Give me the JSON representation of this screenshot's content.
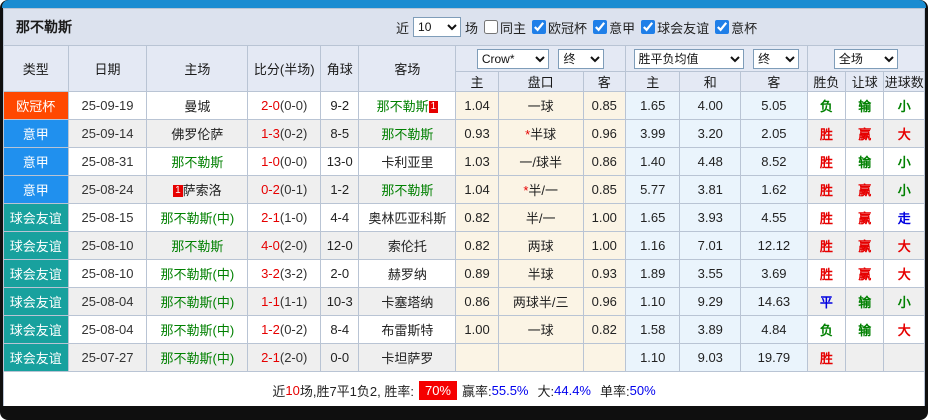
{
  "header": {
    "team": "那不勒斯",
    "near_label": "近",
    "matches_count": "10",
    "matches_unit": "场",
    "same_home": {
      "label": "同主",
      "checked": false
    },
    "filters": [
      {
        "label": "欧冠杯",
        "checked": true
      },
      {
        "label": "意甲",
        "checked": true
      },
      {
        "label": "球会友谊",
        "checked": true
      },
      {
        "label": "意杯",
        "checked": true
      }
    ]
  },
  "controls": {
    "asian_company": "Crow*",
    "asian_time": "终",
    "euro_company": "胜平负均值",
    "euro_time": "终",
    "scope": "全场"
  },
  "table": {
    "columns": [
      "类型",
      "日期",
      "主场",
      "比分(半场)",
      "角球",
      "客场",
      "主",
      "盘口",
      "客",
      "主",
      "和",
      "客",
      "胜负",
      "让球",
      "进球数"
    ],
    "rows": [
      {
        "type": "欧冠杯",
        "type_cls": "ucl",
        "date": "25-09-19",
        "home": {
          "name": "曼城",
          "team": false,
          "badge_before": "",
          "badge_after": ""
        },
        "away": {
          "name": "那不勒斯",
          "team": true,
          "badge_before": "",
          "badge_after": "1"
        },
        "score_ft": "2-0",
        "score_ht": "(0-0)",
        "corners": "9-2",
        "asian": {
          "home": "1.04",
          "star": false,
          "handicap": "一球",
          "away": "0.85"
        },
        "euro": {
          "home": "1.65",
          "draw": "4.00",
          "away": "5.05"
        },
        "result": {
          "t": "负",
          "c": "green"
        },
        "give": {
          "t": "输",
          "c": "green"
        },
        "goals": {
          "t": "小",
          "c": "green"
        }
      },
      {
        "type": "意甲",
        "type_cls": "seriea",
        "date": "25-09-14",
        "home": {
          "name": "佛罗伦萨",
          "team": false,
          "badge_before": "",
          "badge_after": ""
        },
        "away": {
          "name": "那不勒斯",
          "team": true,
          "badge_before": "",
          "badge_after": ""
        },
        "score_ft": "1-3",
        "score_ht": "(0-2)",
        "corners": "8-5",
        "asian": {
          "home": "0.93",
          "star": true,
          "handicap": "半球",
          "away": "0.96"
        },
        "euro": {
          "home": "3.99",
          "draw": "3.20",
          "away": "2.05"
        },
        "result": {
          "t": "胜",
          "c": "red"
        },
        "give": {
          "t": "赢",
          "c": "red"
        },
        "goals": {
          "t": "大",
          "c": "red"
        }
      },
      {
        "type": "意甲",
        "type_cls": "seriea",
        "date": "25-08-31",
        "home": {
          "name": "那不勒斯",
          "team": true,
          "badge_before": "",
          "badge_after": ""
        },
        "away": {
          "name": "卡利亚里",
          "team": false,
          "badge_before": "",
          "badge_after": ""
        },
        "score_ft": "1-0",
        "score_ht": "(0-0)",
        "corners": "13-0",
        "asian": {
          "home": "1.03",
          "star": false,
          "handicap": "一/球半",
          "away": "0.86"
        },
        "euro": {
          "home": "1.40",
          "draw": "4.48",
          "away": "8.52"
        },
        "result": {
          "t": "胜",
          "c": "red"
        },
        "give": {
          "t": "输",
          "c": "green"
        },
        "goals": {
          "t": "小",
          "c": "green"
        }
      },
      {
        "type": "意甲",
        "type_cls": "seriea",
        "date": "25-08-24",
        "home": {
          "name": "萨索洛",
          "team": false,
          "badge_before": "1",
          "badge_after": ""
        },
        "away": {
          "name": "那不勒斯",
          "team": true,
          "badge_before": "",
          "badge_after": ""
        },
        "score_ft": "0-2",
        "score_ht": "(0-1)",
        "corners": "1-2",
        "asian": {
          "home": "1.04",
          "star": true,
          "handicap": "半/一",
          "away": "0.85"
        },
        "euro": {
          "home": "5.77",
          "draw": "3.81",
          "away": "1.62"
        },
        "result": {
          "t": "胜",
          "c": "red"
        },
        "give": {
          "t": "赢",
          "c": "red"
        },
        "goals": {
          "t": "小",
          "c": "green"
        }
      },
      {
        "type": "球会友谊",
        "type_cls": "friendly",
        "date": "25-08-15",
        "home": {
          "name": "那不勒斯(中)",
          "team": true,
          "badge_before": "",
          "badge_after": ""
        },
        "away": {
          "name": "奥林匹亚科斯",
          "team": false,
          "badge_before": "",
          "badge_after": ""
        },
        "score_ft": "2-1",
        "score_ht": "(1-0)",
        "corners": "4-4",
        "asian": {
          "home": "0.82",
          "star": false,
          "handicap": "半/一",
          "away": "1.00"
        },
        "euro": {
          "home": "1.65",
          "draw": "3.93",
          "away": "4.55"
        },
        "result": {
          "t": "胜",
          "c": "red"
        },
        "give": {
          "t": "赢",
          "c": "red"
        },
        "goals": {
          "t": "走",
          "c": "blue"
        }
      },
      {
        "type": "球会友谊",
        "type_cls": "friendly",
        "date": "25-08-10",
        "home": {
          "name": "那不勒斯",
          "team": true,
          "badge_before": "",
          "badge_after": ""
        },
        "away": {
          "name": "索伦托",
          "team": false,
          "badge_before": "",
          "badge_after": ""
        },
        "score_ft": "4-0",
        "score_ht": "(2-0)",
        "corners": "12-0",
        "asian": {
          "home": "0.82",
          "star": false,
          "handicap": "两球",
          "away": "1.00"
        },
        "euro": {
          "home": "1.16",
          "draw": "7.01",
          "away": "12.12"
        },
        "result": {
          "t": "胜",
          "c": "red"
        },
        "give": {
          "t": "赢",
          "c": "red"
        },
        "goals": {
          "t": "大",
          "c": "red"
        }
      },
      {
        "type": "球会友谊",
        "type_cls": "friendly",
        "date": "25-08-10",
        "home": {
          "name": "那不勒斯(中)",
          "team": true,
          "badge_before": "",
          "badge_after": ""
        },
        "away": {
          "name": "赫罗纳",
          "team": false,
          "badge_before": "",
          "badge_after": ""
        },
        "score_ft": "3-2",
        "score_ht": "(3-2)",
        "corners": "2-0",
        "asian": {
          "home": "0.89",
          "star": false,
          "handicap": "半球",
          "away": "0.93"
        },
        "euro": {
          "home": "1.89",
          "draw": "3.55",
          "away": "3.69"
        },
        "result": {
          "t": "胜",
          "c": "red"
        },
        "give": {
          "t": "赢",
          "c": "red"
        },
        "goals": {
          "t": "大",
          "c": "red"
        }
      },
      {
        "type": "球会友谊",
        "type_cls": "friendly",
        "date": "25-08-04",
        "home": {
          "name": "那不勒斯(中)",
          "team": true,
          "badge_before": "",
          "badge_after": ""
        },
        "away": {
          "name": "卡塞塔纳",
          "team": false,
          "badge_before": "",
          "badge_after": ""
        },
        "score_ft": "1-1",
        "score_ht": "(1-1)",
        "corners": "10-3",
        "asian": {
          "home": "0.86",
          "star": false,
          "handicap": "两球半/三",
          "away": "0.96"
        },
        "euro": {
          "home": "1.10",
          "draw": "9.29",
          "away": "14.63"
        },
        "result": {
          "t": "平",
          "c": "blue"
        },
        "give": {
          "t": "输",
          "c": "green"
        },
        "goals": {
          "t": "小",
          "c": "green"
        }
      },
      {
        "type": "球会友谊",
        "type_cls": "friendly",
        "date": "25-08-04",
        "home": {
          "name": "那不勒斯(中)",
          "team": true,
          "badge_before": "",
          "badge_after": ""
        },
        "away": {
          "name": "布雷斯特",
          "team": false,
          "badge_before": "",
          "badge_after": ""
        },
        "score_ft": "1-2",
        "score_ht": "(0-2)",
        "corners": "8-4",
        "asian": {
          "home": "1.00",
          "star": false,
          "handicap": "一球",
          "away": "0.82"
        },
        "euro": {
          "home": "1.58",
          "draw": "3.89",
          "away": "4.84"
        },
        "result": {
          "t": "负",
          "c": "green"
        },
        "give": {
          "t": "输",
          "c": "green"
        },
        "goals": {
          "t": "大",
          "c": "red"
        }
      },
      {
        "type": "球会友谊",
        "type_cls": "friendly",
        "date": "25-07-27",
        "home": {
          "name": "那不勒斯(中)",
          "team": true,
          "badge_before": "",
          "badge_after": ""
        },
        "away": {
          "name": "卡坦萨罗",
          "team": false,
          "badge_before": "",
          "badge_after": ""
        },
        "score_ft": "2-1",
        "score_ht": "(2-0)",
        "corners": "0-0",
        "asian": {
          "home": "",
          "star": false,
          "handicap": "",
          "away": ""
        },
        "euro": {
          "home": "1.10",
          "draw": "9.03",
          "away": "19.79"
        },
        "result": {
          "t": "胜",
          "c": "red"
        },
        "give": {
          "t": "",
          "c": ""
        },
        "goals": {
          "t": "",
          "c": ""
        }
      }
    ]
  },
  "footer": {
    "near": "近",
    "count": "10",
    "mid": "场,胜7平1负2, 胜率:",
    "win_rate": "70%",
    "win_label": "赢率:",
    "win_val": "55.5%",
    "big_label": "大:",
    "big_val": "44.4%",
    "single_label": "单率:",
    "single_val": "50%"
  }
}
